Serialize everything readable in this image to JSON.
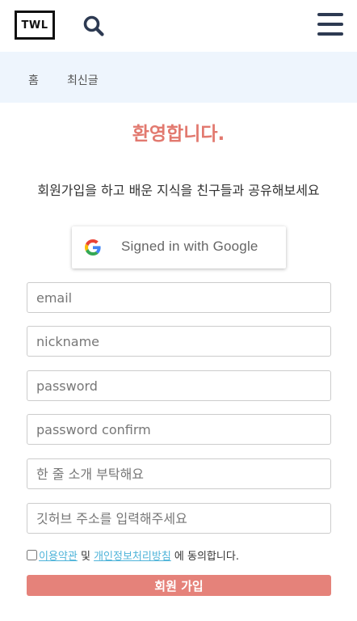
{
  "header": {
    "logo_text": "TWL",
    "search_icon": "search-icon",
    "menu_icon": "hamburger-menu-icon"
  },
  "nav": {
    "items": [
      {
        "label": "홈"
      },
      {
        "label": "최신글"
      }
    ]
  },
  "main": {
    "title": "환영합니다.",
    "description": "회원가입을 하고 배운 지식을 친구들과 공유해보세요",
    "google_button_label": "Signed in with Google",
    "google_icon": "google-g-icon"
  },
  "form": {
    "email_placeholder": "email",
    "nickname_placeholder": "nickname",
    "password_placeholder": "password",
    "password_confirm_placeholder": "password confirm",
    "intro_placeholder": "한 줄 소개 부탁해요",
    "github_placeholder": "깃허브 주소를 입력해주세요",
    "agree": {
      "terms_link": "이용약관",
      "conjunction": "및",
      "privacy_link": "개인정보처리방침",
      "suffix": "에 동의합니다."
    },
    "submit_label": "회원 가입"
  },
  "colors": {
    "accent": "#e2796f",
    "button": "#e5827a",
    "nav_bg": "#eef5fd",
    "link": "#4fb4d9",
    "icon_dark": "#2d3a52"
  }
}
